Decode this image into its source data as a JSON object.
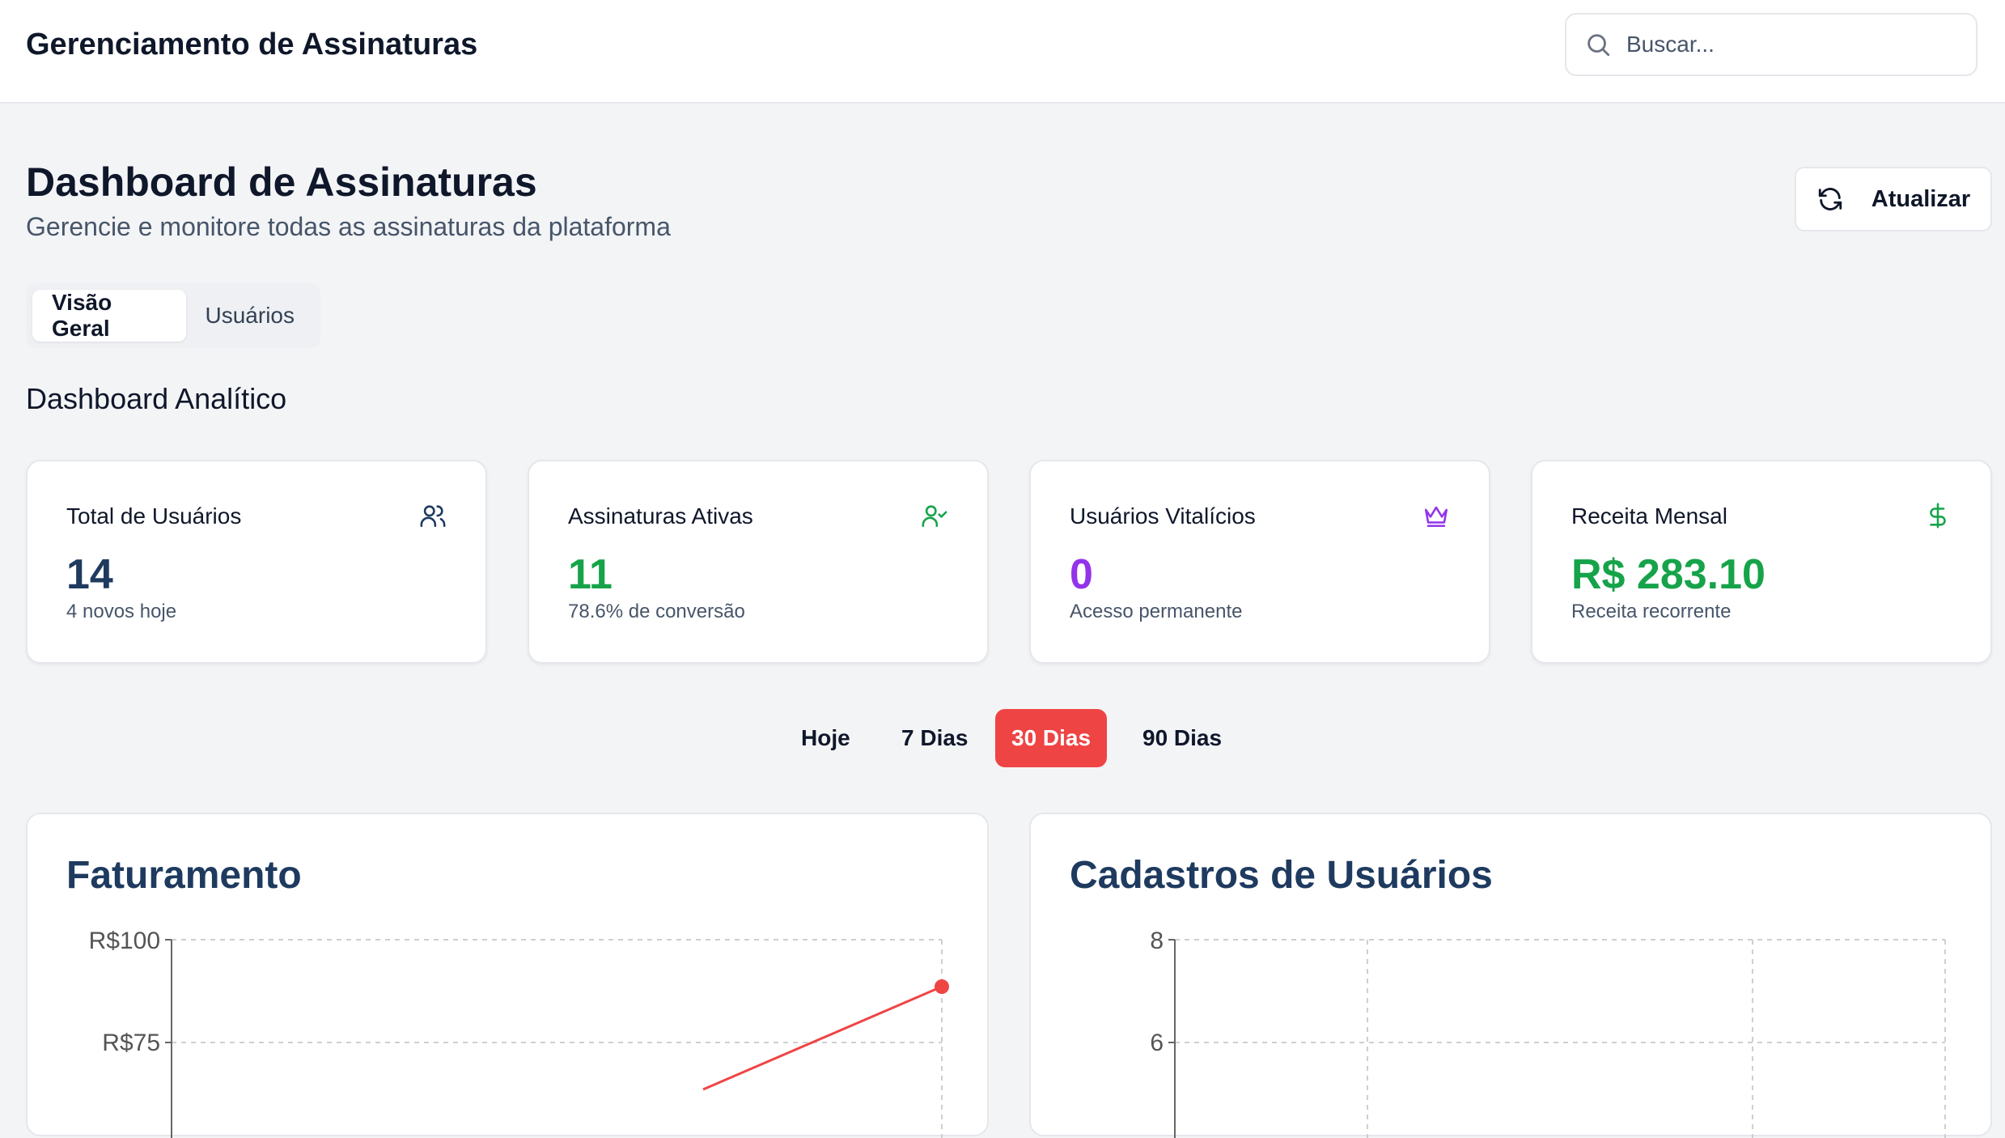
{
  "header": {
    "app_title": "Gerenciamento de Assinaturas",
    "search_placeholder": "Buscar..."
  },
  "page": {
    "title": "Dashboard de Assinaturas",
    "subtitle": "Gerencie e monitore todas as assinaturas da plataforma",
    "refresh_label": "Atualizar"
  },
  "tabs": [
    {
      "label": "Visão Geral",
      "active": true
    },
    {
      "label": "Usuários",
      "active": false
    }
  ],
  "section_title": "Dashboard Analítico",
  "stats": [
    {
      "label": "Total de Usuários",
      "value": "14",
      "sub": "4 novos hoje",
      "color": "#1e3a5f",
      "icon": "users-icon"
    },
    {
      "label": "Assinaturas Ativas",
      "value": "11",
      "sub": "78.6% de conversão",
      "color": "#16a34a",
      "icon": "user-check-icon"
    },
    {
      "label": "Usuários Vitalícios",
      "value": "0",
      "sub": "Acesso permanente",
      "color": "#9333ea",
      "icon": "crown-icon"
    },
    {
      "label": "Receita Mensal",
      "value": "R$ 283.10",
      "sub": "Receita recorrente",
      "color": "#16a34a",
      "icon": "dollar-icon"
    }
  ],
  "periods": [
    {
      "label": "Hoje",
      "active": false
    },
    {
      "label": "7 Dias",
      "active": false
    },
    {
      "label": "30 Dias",
      "active": true
    },
    {
      "label": "90 Dias",
      "active": false
    }
  ],
  "colors": {
    "accent": "#ef4444",
    "line": "#ef4444"
  },
  "chart_data": [
    {
      "type": "line",
      "title": "Faturamento",
      "y_tick_labels": [
        "R$100",
        "R$75"
      ],
      "y_ticks": [
        100,
        75
      ],
      "grid": true,
      "series": [
        {
          "points_visible_end_value": 88
        }
      ]
    },
    {
      "type": "line",
      "title": "Cadastros de Usuários",
      "y_tick_labels": [
        "8",
        "6"
      ],
      "y_ticks": [
        8,
        6
      ],
      "grid": true
    }
  ]
}
